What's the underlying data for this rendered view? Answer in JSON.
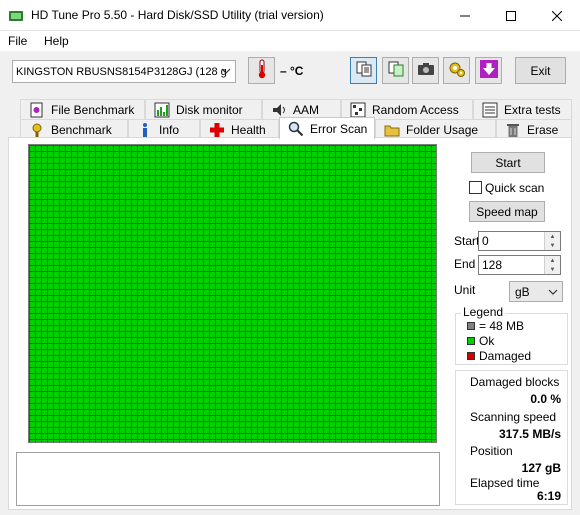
{
  "window": {
    "title": "HD Tune Pro 5.50 - Hard Disk/SSD Utility (trial version)"
  },
  "menu": {
    "file": "File",
    "help": "Help"
  },
  "toolbar": {
    "drive": "KINGSTON RBUSNS8154P3128GJ (128 g",
    "temperature": "– °C",
    "exit_label": "Exit"
  },
  "tabs_top": [
    {
      "label": "File Benchmark",
      "icon": "file-benchmark-icon"
    },
    {
      "label": "Disk monitor",
      "icon": "disk-monitor-icon"
    },
    {
      "label": "AAM",
      "icon": "speaker-icon"
    },
    {
      "label": "Random Access",
      "icon": "random-access-icon"
    },
    {
      "label": "Extra tests",
      "icon": "extra-tests-icon"
    }
  ],
  "tabs_bottom": [
    {
      "label": "Benchmark",
      "icon": "benchmark-icon"
    },
    {
      "label": "Info",
      "icon": "info-icon"
    },
    {
      "label": "Health",
      "icon": "health-icon"
    },
    {
      "label": "Error Scan",
      "icon": "magnifier-icon",
      "active": true
    },
    {
      "label": "Folder Usage",
      "icon": "folder-icon"
    },
    {
      "label": "Erase",
      "icon": "trash-icon"
    }
  ],
  "scan": {
    "start_button": "Start",
    "quick_scan_label": "Quick scan",
    "quick_scan_checked": false,
    "speed_map_button": "Speed map",
    "start_label": "Start",
    "start_value": "0",
    "end_label": "End",
    "end_value": "128",
    "unit_label": "Unit",
    "unit_value": "gB"
  },
  "legend": {
    "title": "Legend",
    "block_size": "= 48 MB",
    "ok": "Ok",
    "damaged": "Damaged",
    "colors": {
      "block": "#808080",
      "ok": "#00d000",
      "damaged": "#d00000"
    }
  },
  "stats": {
    "damaged_blocks_label": "Damaged blocks",
    "damaged_blocks_value": "0.0 %",
    "scanning_speed_label": "Scanning speed",
    "scanning_speed_value": "317.5 MB/s",
    "position_label": "Position",
    "position_value": "127 gB",
    "elapsed_label": "Elapsed time",
    "elapsed_value": "6:19"
  },
  "colors": {
    "grid_ok": "#00d000",
    "grid_line": "#1a6a1a"
  }
}
